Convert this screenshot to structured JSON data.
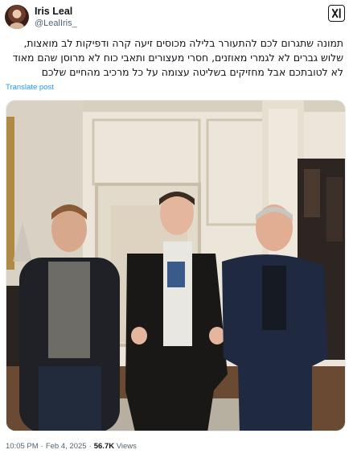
{
  "author": {
    "display_name": "Iris Leal",
    "handle": "@LealIris_"
  },
  "grok_button": {
    "icon": "xai-grok-icon",
    "label": "xI"
  },
  "tweet": {
    "lines": [
      "תמונה שתגרום לכם להתעורר בלילה מכוסים זיעה קרה ודפיקות לב מואצות,",
      "שלוש גברים לא לגמרי מאוזנים, חסרי מעצורים ותאבי כוח לא מרוסן שהם מאוד",
      "לא לטובתכם אבל מחזיקים בשליטה עצומה על כל מרכיב מהחיים שלכם"
    ],
    "translate_label": "Translate post"
  },
  "media": {
    "description_icon": "photo-image",
    "alt": ""
  },
  "meta": {
    "time": "10:05 PM",
    "date": "Feb 4, 2025",
    "views_count": "56.7K",
    "views_label": "Views"
  },
  "colors": {
    "text": "#0f1419",
    "secondary": "#536471",
    "link": "#1d9bf0"
  }
}
